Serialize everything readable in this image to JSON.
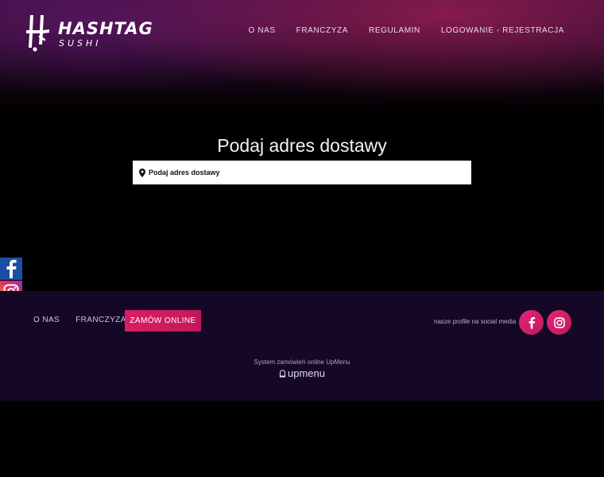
{
  "brand": {
    "title": "HASHTAG",
    "subtitle": "SUSHI"
  },
  "nav": {
    "items": [
      {
        "label": "O NAS"
      },
      {
        "label": "FRANCZYZA"
      },
      {
        "label": "REGULAMIN"
      },
      {
        "label": "LOGOWANIE - REJESTRACJA"
      }
    ]
  },
  "main": {
    "headline": "Podaj adres dostawy",
    "address_placeholder": "Podaj adres dostawy"
  },
  "social_bar": {
    "icons": [
      "facebook-icon",
      "instagram-icon",
      "tiktok-icon",
      "tripadvisor-icon"
    ]
  },
  "footer": {
    "nav": [
      {
        "label": "O NAS"
      },
      {
        "label": "FRANCZYZA"
      }
    ],
    "order_label": "ZAMÓW ONLINE",
    "social_label": "nasze profile na social media",
    "system_text": "System zamówień online UpMenu",
    "upmenu_label": "upmenu"
  },
  "colors": {
    "accent": "#d91e63",
    "footer_bg": "#150726",
    "hero_top": "#3a0d3e"
  }
}
